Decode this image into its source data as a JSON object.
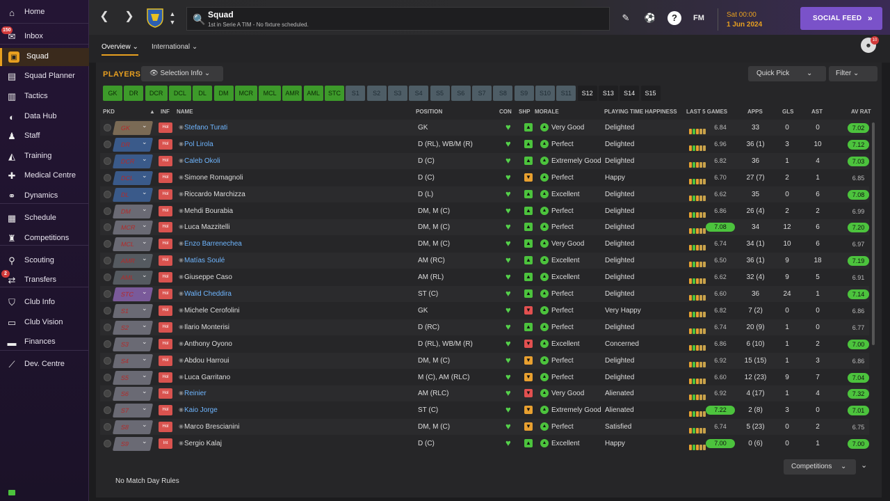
{
  "sidebar": {
    "items": [
      {
        "label": "Home",
        "icon": "home-icon"
      },
      {
        "label": "Inbox",
        "icon": "inbox-icon",
        "badge": "150"
      },
      {
        "label": "Squad",
        "icon": "squad-icon",
        "active": true
      },
      {
        "label": "Squad Planner",
        "icon": "clipboard-icon"
      },
      {
        "label": "Tactics",
        "icon": "tactics-icon"
      },
      {
        "label": "Data Hub",
        "icon": "chart-icon"
      },
      {
        "label": "Staff",
        "icon": "staff-icon"
      },
      {
        "label": "Training",
        "icon": "training-icon"
      },
      {
        "label": "Medical Centre",
        "icon": "medical-icon"
      },
      {
        "label": "Dynamics",
        "icon": "dynamics-icon"
      },
      {
        "label": "Schedule",
        "icon": "calendar-icon"
      },
      {
        "label": "Competitions",
        "icon": "trophy-icon"
      },
      {
        "label": "Scouting",
        "icon": "search-icon"
      },
      {
        "label": "Transfers",
        "icon": "transfers-icon",
        "badge": "2"
      },
      {
        "label": "Club Info",
        "icon": "shield-icon"
      },
      {
        "label": "Club Vision",
        "icon": "briefcase-icon"
      },
      {
        "label": "Finances",
        "icon": "money-icon"
      },
      {
        "label": "Dev. Centre",
        "icon": "dev-centre-icon"
      }
    ]
  },
  "topbar": {
    "title": "Squad",
    "subtitle": "1st in Serie A TIM - No fixture scheduled.",
    "fm_label": "FM",
    "date_day": "Sat 00:00",
    "date_full": "1 Jun 2024",
    "social_label": "SOCIAL FEED"
  },
  "subtabs": {
    "overview": "Overview",
    "international": "International"
  },
  "avatar_badge": "10",
  "players": {
    "heading": "PLAYERS",
    "selection_info": "Selection Info",
    "quick_pick": "Quick Pick",
    "filter": "Filter"
  },
  "chips": [
    "GK",
    "DR",
    "DCR",
    "DCL",
    "DL",
    "DM",
    "MCR",
    "MCL",
    "AMR",
    "AML",
    "STC",
    "S1",
    "S2",
    "S3",
    "S4",
    "S5",
    "S6",
    "S7",
    "S8",
    "S9",
    "S10",
    "S11",
    "S12",
    "S13",
    "S14",
    "S15"
  ],
  "headers": {
    "pkd": "PKD",
    "inf": "INF",
    "name": "NAME",
    "position": "POSITION",
    "con": "CON",
    "shp": "SHP",
    "morale": "MORALE",
    "pth": "PLAYING TIME HAPPINESS",
    "last5": "LAST 5 GAMES",
    "apps": "APPS",
    "gls": "GLS",
    "ast": "AST",
    "avrat": "AV RAT"
  },
  "rows": [
    {
      "pkd": "GK",
      "inf": "Hol",
      "name": "Stefano Turati",
      "link": true,
      "pos": "GK",
      "shp": "up",
      "morale": "Very Good",
      "pth": "Delighted",
      "l5": "6.84",
      "apps": "33",
      "gls": "0",
      "ast": "0",
      "avr": "7.02",
      "hot": true
    },
    {
      "pkd": "DR",
      "inf": "Hol",
      "name": "Pol Lirola",
      "link": true,
      "pos": "D (RL), WB/M (R)",
      "shp": "up",
      "morale": "Perfect",
      "pth": "Delighted",
      "l5": "6.96",
      "apps": "36 (1)",
      "gls": "3",
      "ast": "10",
      "avr": "7.12",
      "hot": true
    },
    {
      "pkd": "DCR",
      "inf": "Hol",
      "name": "Caleb Okoli",
      "link": true,
      "pos": "D (C)",
      "shp": "up",
      "morale": "Extremely Good",
      "pth": "Delighted",
      "l5": "6.82",
      "apps": "36",
      "gls": "1",
      "ast": "4",
      "avr": "7.03",
      "hot": true
    },
    {
      "pkd": "DCL",
      "inf": "Hol",
      "name": "Simone Romagnoli",
      "link": false,
      "pos": "D (C)",
      "shp": "down",
      "morale": "Perfect",
      "pth": "Happy",
      "l5": "6.70",
      "apps": "27 (7)",
      "gls": "2",
      "ast": "1",
      "avr": "6.85",
      "hot": false
    },
    {
      "pkd": "DL",
      "inf": "Hol",
      "name": "Riccardo Marchizza",
      "link": false,
      "pos": "D (L)",
      "shp": "up",
      "morale": "Excellent",
      "pth": "Delighted",
      "l5": "6.62",
      "apps": "35",
      "gls": "0",
      "ast": "6",
      "avr": "7.08",
      "hot": true
    },
    {
      "pkd": "DM",
      "inf": "Hol",
      "name": "Mehdi Bourabia",
      "link": false,
      "pos": "DM, M (C)",
      "shp": "up",
      "morale": "Perfect",
      "pth": "Delighted",
      "l5": "6.86",
      "apps": "26 (4)",
      "gls": "2",
      "ast": "2",
      "avr": "6.99",
      "hot": false
    },
    {
      "pkd": "MCR",
      "inf": "Hol",
      "name": "Luca Mazzitelli",
      "link": false,
      "pos": "DM, M (C)",
      "shp": "up",
      "morale": "Perfect",
      "pth": "Delighted",
      "l5": "7.08",
      "apps": "34",
      "gls": "12",
      "ast": "6",
      "avr": "7.20",
      "hot": true
    },
    {
      "pkd": "MCL",
      "inf": "Hol",
      "name": "Enzo Barrenechea",
      "link": true,
      "pos": "DM, M (C)",
      "shp": "up",
      "morale": "Very Good",
      "pth": "Delighted",
      "l5": "6.74",
      "apps": "34 (1)",
      "gls": "10",
      "ast": "6",
      "avr": "6.97",
      "hot": false
    },
    {
      "pkd": "AMR",
      "inf": "Hol",
      "name": "Matías Soulé",
      "link": true,
      "pos": "AM (RC)",
      "shp": "up",
      "morale": "Excellent",
      "pth": "Delighted",
      "l5": "6.50",
      "apps": "36 (1)",
      "gls": "9",
      "ast": "18",
      "avr": "7.19",
      "hot": true
    },
    {
      "pkd": "AML",
      "inf": "Hol",
      "name": "Giuseppe Caso",
      "link": false,
      "pos": "AM (RL)",
      "shp": "up",
      "morale": "Excellent",
      "pth": "Delighted",
      "l5": "6.62",
      "apps": "32 (4)",
      "gls": "9",
      "ast": "5",
      "avr": "6.91",
      "hot": false
    },
    {
      "pkd": "STC",
      "inf": "Hol",
      "name": "Walid Cheddira",
      "link": true,
      "pos": "ST (C)",
      "shp": "up",
      "morale": "Perfect",
      "pth": "Delighted",
      "l5": "6.60",
      "apps": "36",
      "gls": "24",
      "ast": "1",
      "avr": "7.14",
      "hot": true
    },
    {
      "pkd": "S1",
      "inf": "Hol",
      "name": "Michele Cerofolini",
      "link": false,
      "pos": "GK",
      "shp": "red",
      "morale": "Perfect",
      "pth": "Very Happy",
      "l5": "6.82",
      "apps": "7 (2)",
      "gls": "0",
      "ast": "0",
      "avr": "6.86",
      "hot": false
    },
    {
      "pkd": "S2",
      "inf": "Hol",
      "name": "Ilario Monterisi",
      "link": false,
      "pos": "D (RC)",
      "shp": "up",
      "morale": "Perfect",
      "pth": "Delighted",
      "l5": "6.74",
      "apps": "20 (9)",
      "gls": "1",
      "ast": "0",
      "avr": "6.77",
      "hot": false
    },
    {
      "pkd": "S3",
      "inf": "Hol",
      "name": "Anthony Oyono",
      "link": false,
      "pos": "D (RL), WB/M (R)",
      "shp": "red",
      "morale": "Excellent",
      "pth": "Concerned",
      "l5": "6.86",
      "apps": "6 (10)",
      "gls": "1",
      "ast": "2",
      "avr": "7.00",
      "hot": true
    },
    {
      "pkd": "S4",
      "inf": "Hol",
      "name": "Abdou Harroui",
      "link": false,
      "pos": "DM, M (C)",
      "shp": "down",
      "morale": "Perfect",
      "pth": "Delighted",
      "l5": "6.92",
      "apps": "15 (15)",
      "gls": "1",
      "ast": "3",
      "avr": "6.86",
      "hot": false
    },
    {
      "pkd": "S5",
      "inf": "Hol",
      "name": "Luca Garritano",
      "link": false,
      "pos": "M (C), AM (RLC)",
      "shp": "down",
      "morale": "Perfect",
      "pth": "Delighted",
      "l5": "6.60",
      "apps": "12 (23)",
      "gls": "9",
      "ast": "7",
      "avr": "7.04",
      "hot": true
    },
    {
      "pkd": "S6",
      "inf": "Hol",
      "name": "Reinier",
      "link": true,
      "pos": "AM (RLC)",
      "shp": "red",
      "morale": "Very Good",
      "pth": "Alienated",
      "l5": "6.92",
      "apps": "4 (17)",
      "gls": "1",
      "ast": "4",
      "avr": "7.32",
      "hot": true
    },
    {
      "pkd": "S7",
      "inf": "Hol",
      "name": "Kaio Jorge",
      "link": true,
      "pos": "ST (C)",
      "shp": "down",
      "morale": "Extremely Good",
      "pth": "Alienated",
      "l5": "7.22",
      "apps": "2 (8)",
      "gls": "3",
      "ast": "0",
      "avr": "7.01",
      "hot": true
    },
    {
      "pkd": "S8",
      "inf": "Hol",
      "name": "Marco Brescianini",
      "link": false,
      "pos": "DM, M (C)",
      "shp": "down",
      "morale": "Perfect",
      "pth": "Satisfied",
      "l5": "6.74",
      "apps": "5 (23)",
      "gls": "0",
      "ast": "2",
      "avr": "6.75",
      "hot": false
    },
    {
      "pkd": "S9",
      "inf": "Int",
      "name": "Sergio Kalaj",
      "link": false,
      "pos": "D (C)",
      "shp": "up",
      "morale": "Excellent",
      "pth": "Happy",
      "l5": "7.00",
      "apps": "0 (6)",
      "gls": "0",
      "ast": "1",
      "avr": "7.00",
      "hot": true
    }
  ],
  "competitions_label": "Competitions",
  "no_match_day": "No Match Day Rules"
}
